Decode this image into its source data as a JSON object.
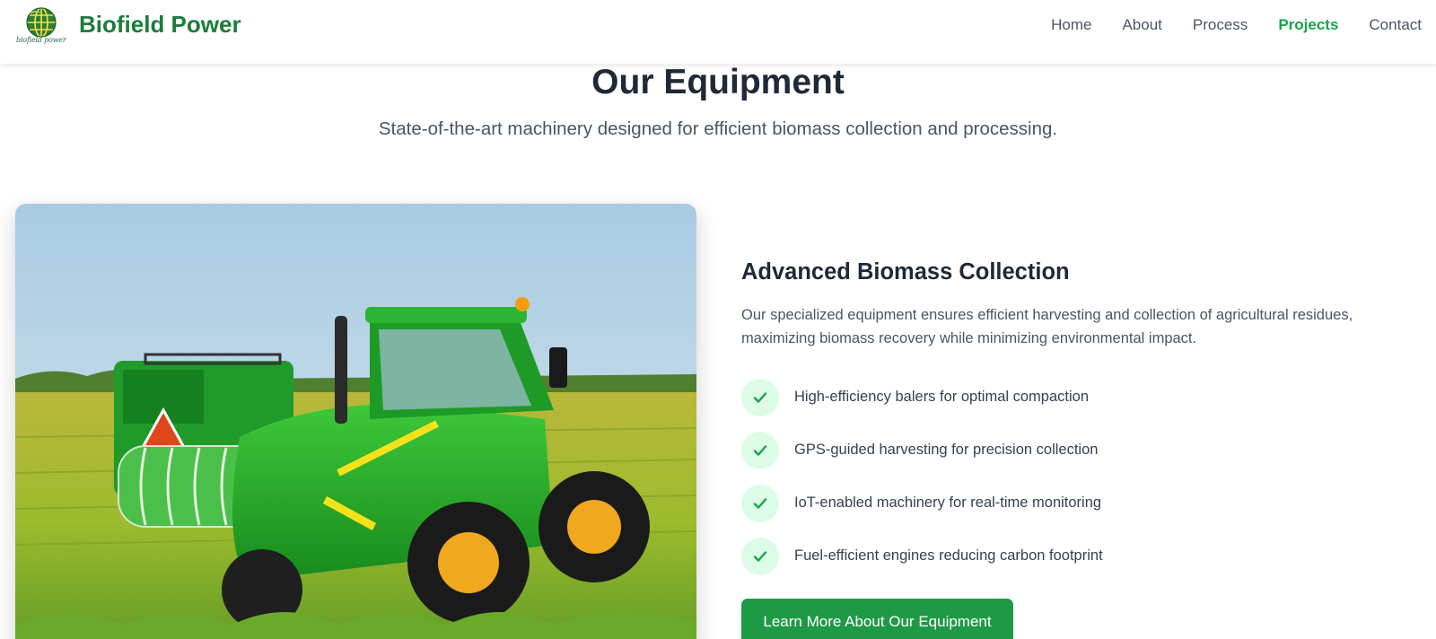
{
  "header": {
    "logo_caption": "biofield power",
    "brand": "Biofield Power",
    "nav": [
      {
        "label": "Home",
        "active": false
      },
      {
        "label": "About",
        "active": false
      },
      {
        "label": "Process",
        "active": false
      },
      {
        "label": "Projects",
        "active": true
      },
      {
        "label": "Contact",
        "active": false
      }
    ]
  },
  "section": {
    "title": "Our Equipment",
    "subtitle": "State-of-the-art machinery designed for efficient biomass collection and processing."
  },
  "feature": {
    "title": "Advanced Biomass Collection",
    "description": "Our specialized equipment ensures efficient harvesting and collection of agricultural residues, maximizing biomass recovery while minimizing environmental impact.",
    "items": [
      "High-efficiency balers for optimal compaction",
      "GPS-guided harvesting for precision collection",
      "IoT-enabled machinery for real-time monitoring",
      "Fuel-efficient engines reducing carbon footprint"
    ],
    "cta_label": "Learn More About Our Equipment",
    "image_subject": "green tractor with baler in a crop field"
  },
  "colors": {
    "brand_green": "#1e7b3b",
    "active_nav": "#16a34a",
    "button": "#1e9a46",
    "check_bg": "#dcfce7"
  },
  "icons": [
    "globe-logo-icon",
    "check-icon"
  ]
}
